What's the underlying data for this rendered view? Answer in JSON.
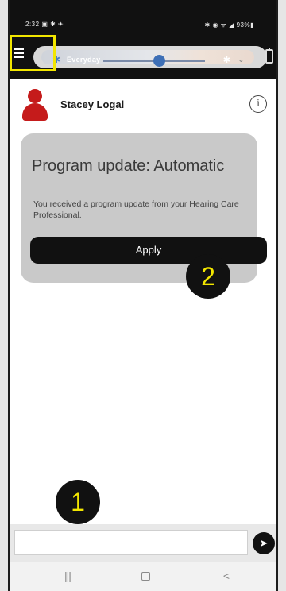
{
  "status_bar": {
    "time": "2:32",
    "left_icons": "▣ ✱ ✈",
    "right_icons": "✱ ◉ ᯤ ◢ 93%▮"
  },
  "app_bar": {
    "program_label": "Everyday",
    "volume_level": 0.55
  },
  "profile": {
    "name": "Stacey Logal",
    "info_glyph": "i"
  },
  "update_card": {
    "title": "Program update: Automatic",
    "message": "You received a program update from your Hearing Care Professional.",
    "apply_label": "Apply"
  },
  "callouts": {
    "one": "1",
    "two": "2"
  },
  "message_input": {
    "value": "",
    "placeholder": ""
  },
  "send_glyph": "➤",
  "nav_bar": {
    "recents": "|||",
    "back": "<"
  },
  "colors": {
    "highlight": "#f2e600",
    "avatar": "#c51b1b",
    "card": "#c9c9c9",
    "slider_thumb": "#3d6fb6"
  },
  "icons": [
    "menu-icon",
    "bluetooth-icon",
    "chevron-down-icon",
    "battery-icon",
    "avatar-icon",
    "info-icon",
    "send-icon",
    "recents-icon",
    "home-icon",
    "back-icon"
  ]
}
